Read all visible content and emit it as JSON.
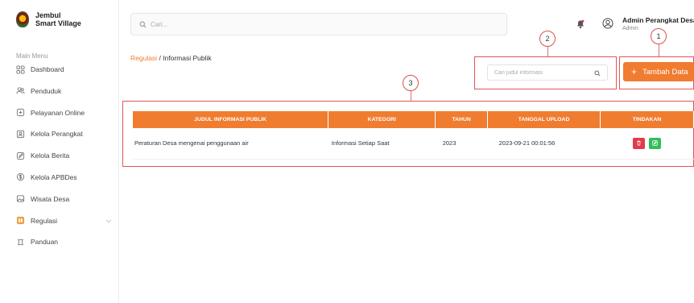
{
  "brand": {
    "line1": "Jembul",
    "line2": "Smart Village"
  },
  "sidebar": {
    "section_title": "Main Menu",
    "items": [
      {
        "label": "Dashboard",
        "icon": "dashboard-icon"
      },
      {
        "label": "Penduduk",
        "icon": "users-icon"
      },
      {
        "label": "Pelayanan Online",
        "icon": "service-icon"
      },
      {
        "label": "Kelola Perangkat",
        "icon": "id-card-icon"
      },
      {
        "label": "Kelola Berita",
        "icon": "edit-icon"
      },
      {
        "label": "Kelola APBDes",
        "icon": "money-icon"
      },
      {
        "label": "Wisata Desa",
        "icon": "image-icon"
      },
      {
        "label": "Regulasi",
        "icon": "book-icon",
        "expandable": true
      },
      {
        "label": "Panduan",
        "icon": "help-icon"
      }
    ]
  },
  "topbar": {
    "search_placeholder": "Cari...",
    "user_name": "Admin Perangkat Desa",
    "user_role": "Admin"
  },
  "breadcrumb": {
    "parent": "Regulasi",
    "separator": " / ",
    "current": "Informasi Publik"
  },
  "filter": {
    "search_placeholder": "Cari judul informasi"
  },
  "actions": {
    "add_label": "Tambah Data"
  },
  "annotations": [
    "1",
    "2",
    "3"
  ],
  "table": {
    "columns": [
      "JUDUL INFORMASI PUBLIK",
      "KATEGORI",
      "TAHUN",
      "TANGGAL UPLOAD",
      "TINDAKAN"
    ],
    "rows": [
      {
        "judul": "Peraturan Desa mengenai penggunaan air",
        "kategori": "Informasi Setiap Saat",
        "tahun": "2023",
        "tanggal": "2023-09-21 00:01:56"
      }
    ]
  },
  "colors": {
    "accent": "#f07c30",
    "annotation": "#e25555",
    "delete": "#e23b4a",
    "edit": "#2fbf5a"
  }
}
